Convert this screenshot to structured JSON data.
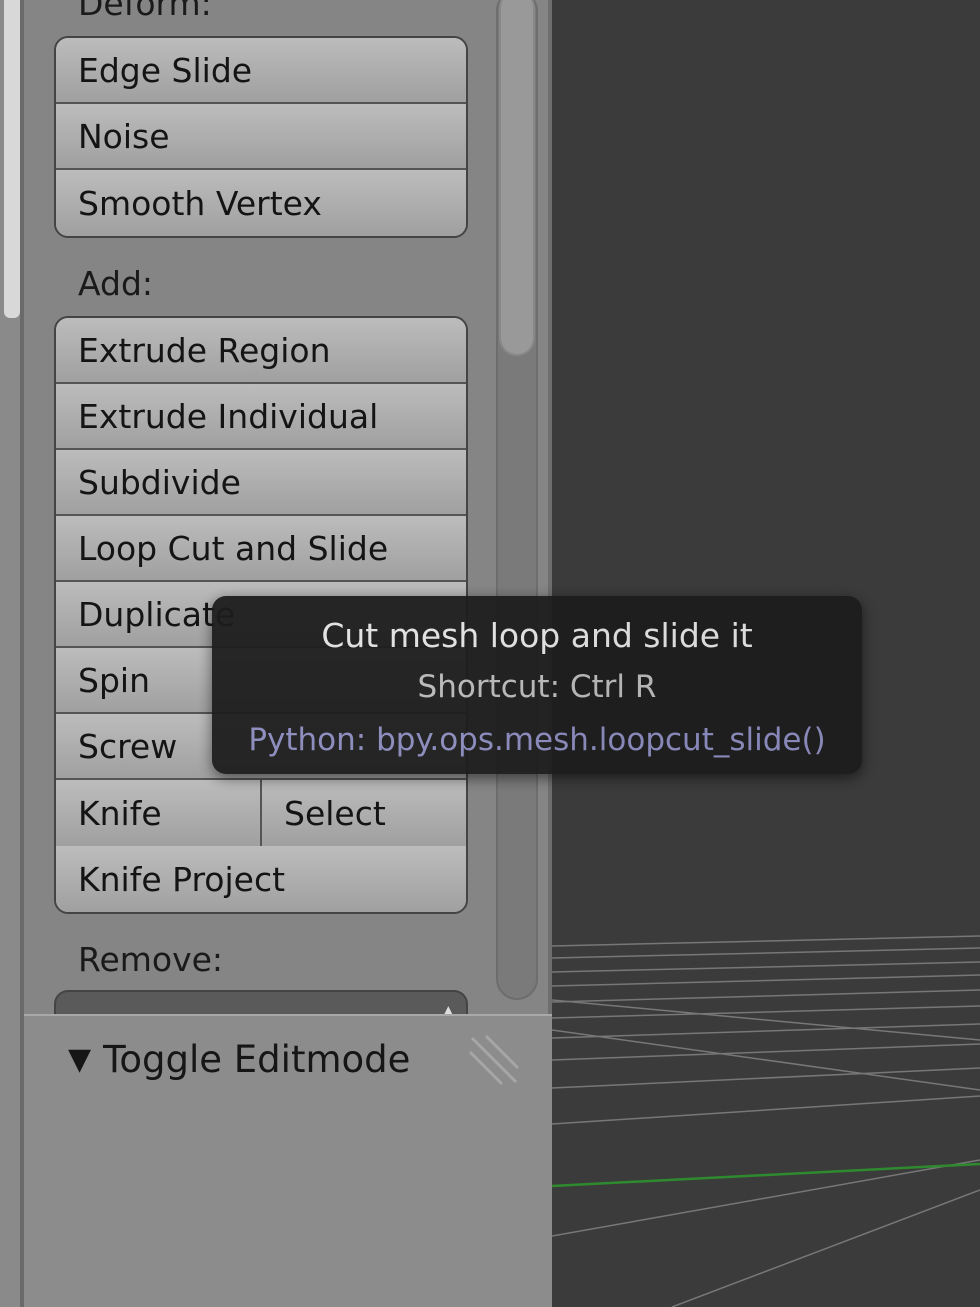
{
  "toolshelf": {
    "deform": {
      "label": "Deform:",
      "buttons": [
        "Edge Slide",
        "Noise",
        "Smooth Vertex"
      ]
    },
    "add": {
      "label": "Add:",
      "buttons": [
        "Extrude Region",
        "Extrude Individual",
        "Subdivide",
        "Loop Cut and Slide",
        "Duplicate",
        "Spin",
        "Screw"
      ],
      "knife_row": [
        "Knife",
        "Select"
      ],
      "last": "Knife Project"
    },
    "remove": {
      "label": "Remove:"
    }
  },
  "lower_panel": {
    "title": "Toggle Editmode"
  },
  "tooltip": {
    "description": "Cut mesh loop and slide it",
    "shortcut": "Shortcut: Ctrl R",
    "python": "Python: bpy.ops.mesh.loopcut_slide()"
  },
  "colors": {
    "panel": "#858585",
    "button": "#b0b0b0",
    "viewport": "#3b3b3b",
    "tooltip_bg": "#1d1d1d",
    "python_text": "#8c8cc0",
    "grid_line": "#7a7a7a",
    "axis_green": "#2f8a2f"
  },
  "icons": {
    "collapse": "triangle-down-icon",
    "grip": "resize-grip-icon",
    "dropdown": "up-down-arrow-icon"
  }
}
